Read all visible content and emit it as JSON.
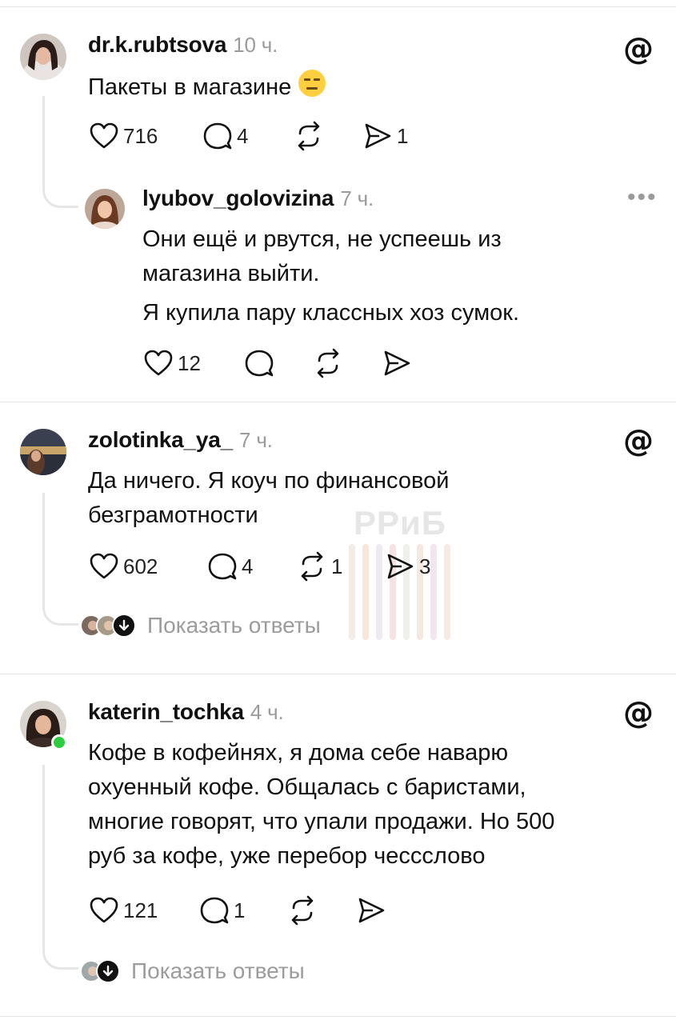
{
  "comments": [
    {
      "username": "dr.k.rubtsova",
      "time": "10 ч.",
      "text": [
        "Пакеты в магазине"
      ],
      "emoji": "expressionless-face-icon",
      "likes": "716",
      "replies": "4",
      "reposts": "",
      "shares": "1"
    },
    {
      "username": "lyubov_golovizina",
      "time": "7 ч.",
      "text": [
        "Они ещё и рвутся, не успеешь из",
        "магазина выйти.",
        "Я купила пару классных хоз сумок."
      ],
      "likes": "12",
      "replies": "",
      "reposts": "",
      "shares": ""
    },
    {
      "username": "zolotinka_ya_",
      "time": "7 ч.",
      "text": [
        "Да ничего. Я коуч по финансовой",
        "безграмотности"
      ],
      "likes": "602",
      "replies": "4",
      "reposts": "1",
      "shares": "3",
      "show_replies": "Показать ответы"
    },
    {
      "username": "katerin_tochka",
      "time": "4 ч.",
      "text": [
        "Кофе в кофейнях, я дома себе наварю",
        "охуенный кофе. Общалась с баристами,",
        "многие говорят, что упали продажи. Но 500",
        "руб за кофе, уже перебор чесcслово"
      ],
      "likes": "121",
      "replies": "1",
      "reposts": "",
      "shares": "",
      "show_replies": "Показать ответы"
    }
  ],
  "watermark": "РРиБ",
  "more_menu": "•••",
  "colors": {
    "text": "#111111",
    "muted": "#9b9b9b",
    "line": "#e6e6e6",
    "online": "#2ecc40"
  }
}
